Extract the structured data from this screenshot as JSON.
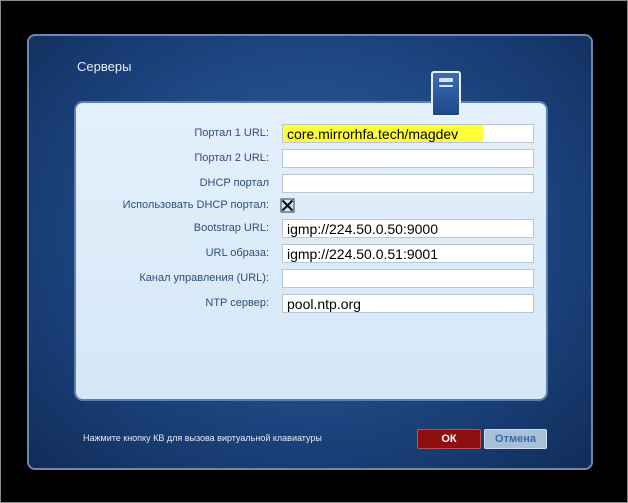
{
  "dialog": {
    "title": "Серверы"
  },
  "form": {
    "portal1": {
      "label": "Портал 1 URL:",
      "value": "core.mirrorhfa.tech/magdev"
    },
    "portal2": {
      "label": "Портал 2 URL:",
      "value": ""
    },
    "dhcp_portal": {
      "label": "DHCP портал",
      "value": ""
    },
    "use_dhcp_portal": {
      "label": "Использовать DHCP портал:",
      "checked": true
    },
    "bootstrap_url": {
      "label": "Bootstrap URL:",
      "value": "igmp://224.50.0.50:9000"
    },
    "image_url": {
      "label": "URL образа:",
      "value": "igmp://224.50.0.51:9001"
    },
    "control_channel": {
      "label": "Канал управления (URL):",
      "value": ""
    },
    "ntp_server": {
      "label": "NTP сервер:",
      "value": "pool.ntp.org"
    }
  },
  "footer": {
    "hint": "Нажмите кнопку КВ для вызова виртуальной клавиатуры",
    "ok_label": "ОК",
    "cancel_label": "Отмена"
  },
  "icons": {
    "server": "server-icon",
    "checkbox": "checkbox-checked-icon"
  },
  "colors": {
    "highlight": "#ffff3a",
    "ok_button": "#8e0e0e",
    "cancel_button": "#a8bfd9",
    "label_text": "#2e4f7a"
  }
}
